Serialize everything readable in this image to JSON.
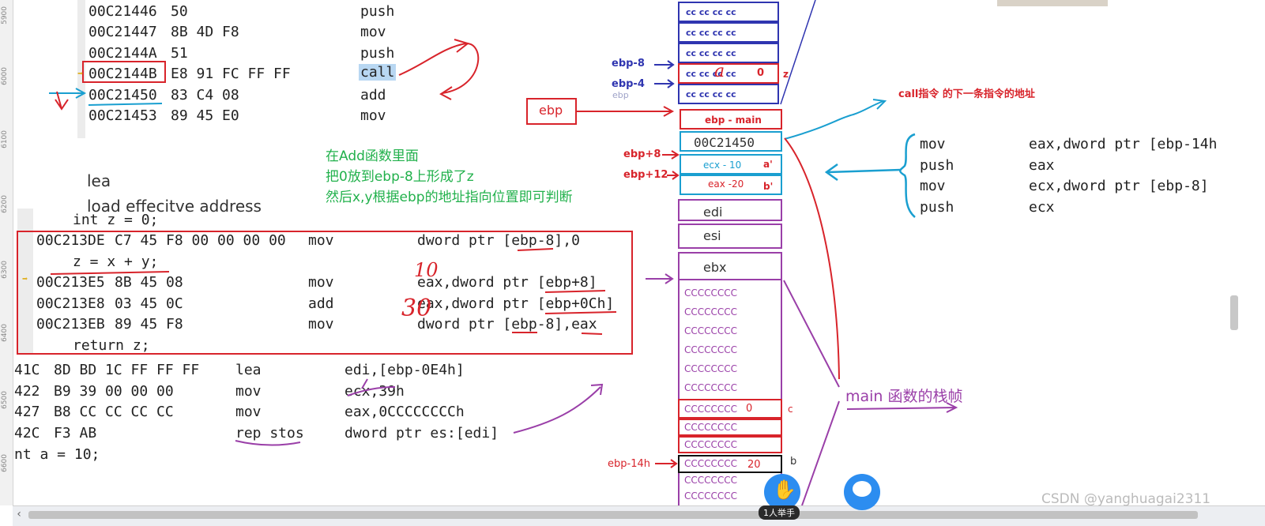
{
  "ruler": {
    "labels": [
      "5900",
      "6000",
      "6100",
      "6200",
      "6300",
      "6400",
      "6500",
      "6600"
    ]
  },
  "top_code": [
    {
      "addr": "00C21446",
      "bytes": "50",
      "mnem": "push"
    },
    {
      "addr": "00C21447",
      "bytes": "8B 4D F8",
      "mnem": "mov"
    },
    {
      "addr": "00C2144A",
      "bytes": "51",
      "mnem": "push"
    },
    {
      "addr": "00C2144B",
      "bytes": "E8 91 FC FF FF",
      "mnem": "call"
    },
    {
      "addr": "00C21450",
      "bytes": "83 C4 08",
      "mnem": "add"
    },
    {
      "addr": "00C21453",
      "bytes": "89 45 E0",
      "mnem": "mov"
    }
  ],
  "lea_note": {
    "line1": "lea",
    "line2": "load effecitve address"
  },
  "green_note": {
    "line1": "在Add函数里面",
    "line2": "把0放到ebp-8上形成了z",
    "line3": "然后x,y根据ebp的地址指向位置即可判断"
  },
  "box_code": {
    "src1": "int z = 0;",
    "row1": {
      "addr": "00C213DE",
      "bytes": "C7 45 F8 00 00 00 00",
      "mnem": "mov",
      "ops": "dword ptr [ebp-8],0"
    },
    "src2": "z = x + y;",
    "row2": {
      "addr": "00C213E5",
      "bytes": "8B 45 08",
      "mnem": "mov",
      "ops": "eax,dword ptr [ebp+8]"
    },
    "row3": {
      "addr": "00C213E8",
      "bytes": "03 45 0C",
      "mnem": "add",
      "ops": "eax,dword ptr [ebp+0Ch]"
    },
    "row4": {
      "addr": "00C213EB",
      "bytes": "89 45 F8",
      "mnem": "mov",
      "ops": "dword ptr [ebp-8],eax"
    },
    "src3": "return z;"
  },
  "bottom_code": [
    {
      "addr": "41C",
      "bytes": "8D BD 1C FF FF FF",
      "mnem": "lea",
      "ops": "edi,[ebp-0E4h]"
    },
    {
      "addr": "422",
      "bytes": "B9 39 00 00 00",
      "mnem": "mov",
      "ops": "ecx,39h"
    },
    {
      "addr": "427",
      "bytes": "B8 CC CC CC CC",
      "mnem": "mov",
      "ops": "eax,0CCCCCCCCh"
    },
    {
      "addr": "42C",
      "bytes": "F3 AB",
      "mnem": "rep stos",
      "ops": "dword ptr es:[edi]"
    }
  ],
  "bottom_src": "nt a = 10;",
  "handwriting": {
    "ten": "10",
    "thirty": "30",
    "z_mark": "z",
    "a_mark": "a"
  },
  "stack": {
    "cc_cell": "cc cc cc cc",
    "z_value": "0",
    "z_label": "z",
    "ebp_main": "ebp - main",
    "ret_addr": "00C21450",
    "ecx_cell": "ecx - 10",
    "ecx_tag": "a'",
    "eax_cell": "eax -20",
    "eax_tag": "b'",
    "edi": "edi",
    "esi": "esi",
    "ebx": "ebx",
    "cccc": "CCCCCCCC",
    "c_value": "0",
    "c_label": "c",
    "b_value": "20",
    "b_label": "b"
  },
  "labels": {
    "ebp_minus8": "ebp-8",
    "ebp_minus4": "ebp-4",
    "ebp_box": "ebp",
    "ebp_plus8": "ebp+8",
    "ebp_plus12": "ebp+12",
    "ebp_minus14h": "ebp-14h",
    "ghost_ebp": "ebp"
  },
  "call_note": "call指令 的下一条指令的地址",
  "main_frame_note": "main 函数的栈帧",
  "right_code": [
    {
      "mnem": "mov",
      "ops": "eax,dword ptr [ebp-14h"
    },
    {
      "mnem": "push",
      "ops": "eax"
    },
    {
      "mnem": "mov",
      "ops": "ecx,dword ptr [ebp-8]"
    },
    {
      "mnem": "push",
      "ops": "ecx"
    }
  ],
  "raise_hand": "1人举手",
  "watermark": "CSDN @yanghuagai2311",
  "colors": {
    "red": "#d8242b",
    "blue": "#2f35b0",
    "cyan": "#1a9fd0",
    "purple": "#9a3fa8",
    "green": "#22b14c"
  }
}
